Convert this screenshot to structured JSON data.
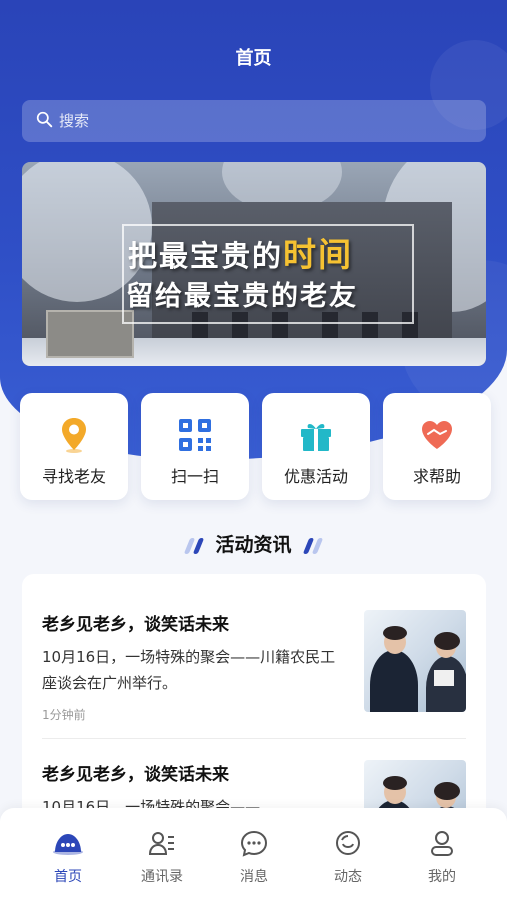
{
  "header": {
    "title": "首页"
  },
  "search": {
    "placeholder": "搜索"
  },
  "banner": {
    "line1_prefix": "把最宝贵的",
    "line1_highlight": "时间",
    "line2": "留给最宝贵的老友"
  },
  "quick_actions": [
    {
      "label": "寻找老友",
      "icon": "location-pin-icon",
      "color": "#f3a929"
    },
    {
      "label": "扫一扫",
      "icon": "qr-code-icon",
      "color": "#2f6fe0"
    },
    {
      "label": "优惠活动",
      "icon": "gift-icon",
      "color": "#22b8c8"
    },
    {
      "label": "求帮助",
      "icon": "help-heart-icon",
      "color": "#ef6a55"
    }
  ],
  "section": {
    "title": "活动资讯"
  },
  "news": [
    {
      "title": "老乡见老乡，谈笑话未来",
      "desc": "10月16日，一场特殊的聚会——川籍农民工座谈会在广州举行。",
      "time": "1分钟前"
    },
    {
      "title": "老乡见老乡，谈笑话未来",
      "desc": "10月16日，一场特殊的聚会——"
    }
  ],
  "tabbar": [
    {
      "label": "首页",
      "icon": "home-chat-icon",
      "active": true
    },
    {
      "label": "通讯录",
      "icon": "contacts-icon",
      "active": false
    },
    {
      "label": "消息",
      "icon": "message-icon",
      "active": false
    },
    {
      "label": "动态",
      "icon": "moments-icon",
      "active": false
    },
    {
      "label": "我的",
      "icon": "profile-icon",
      "active": false
    }
  ],
  "colors": {
    "primary": "#2c47b8",
    "accent": "#f6c232"
  }
}
